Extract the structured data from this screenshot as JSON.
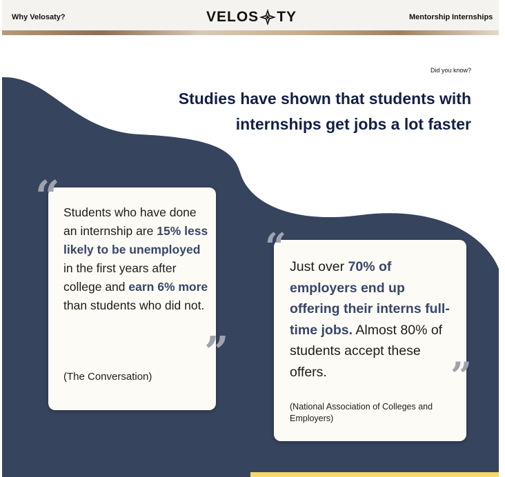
{
  "nav": {
    "why_label": "Why Velosaty?",
    "logo_left": "VELOS",
    "logo_right": "TY",
    "mentorship_label": "Mentorship",
    "internships_label": "Internships"
  },
  "section": {
    "eyebrow": "Did you know?",
    "headline": "Studies have shown that students with internships get jobs a lot faster"
  },
  "cards": [
    {
      "parts": [
        {
          "text": "Students who have done an internship are ",
          "bold": false
        },
        {
          "text": "15% less likely to be unemployed",
          "bold": true
        },
        {
          "text": " in the first years after college and ",
          "bold": false
        },
        {
          "text": "earn 6% more",
          "bold": true
        },
        {
          "text": " than students who did not.",
          "bold": false
        }
      ],
      "source": "(The Conversation)"
    },
    {
      "parts": [
        {
          "text": "Just over ",
          "bold": false
        },
        {
          "text": "70% of employers end up offering their interns full-time jobs.",
          "bold": true
        },
        {
          "text": " Almost 80% of students accept these offers.",
          "bold": false
        }
      ],
      "source": "(National Association of Colleges and Employers)"
    }
  ],
  "colors": {
    "wave": "#37445e",
    "headline": "#132046",
    "highlight": "#37466a",
    "card_bg": "#fdfbf5",
    "accent_yellow": "#f4d86a"
  },
  "icons": {
    "open_quote": "“",
    "close_quote": "”"
  }
}
